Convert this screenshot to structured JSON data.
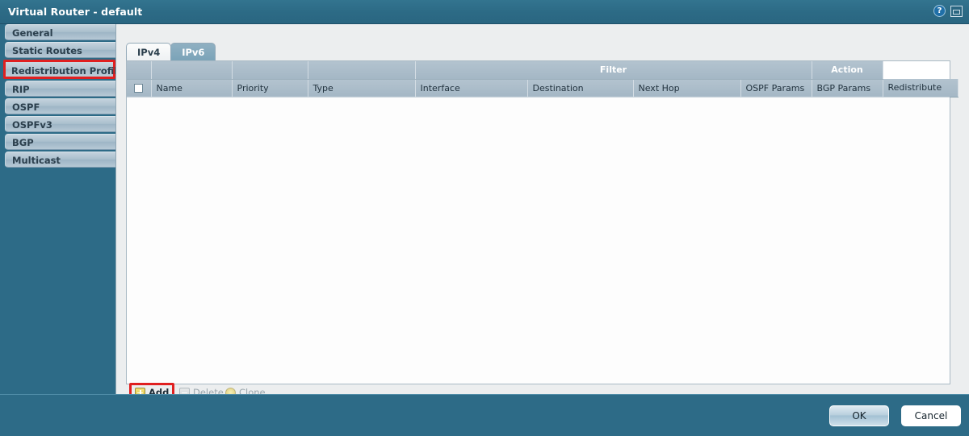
{
  "window": {
    "title": "Virtual Router - default",
    "help_icon": "help-icon",
    "help_glyph": "?",
    "window_icon": "window-icon"
  },
  "sidebar": {
    "items": [
      {
        "label": "General",
        "highlighted": false
      },
      {
        "label": "Static Routes",
        "highlighted": false
      },
      {
        "label": "Redistribution Profile",
        "highlighted": true
      },
      {
        "label": "RIP",
        "highlighted": false
      },
      {
        "label": "OSPF",
        "highlighted": false
      },
      {
        "label": "OSPFv3",
        "highlighted": false
      },
      {
        "label": "BGP",
        "highlighted": false
      },
      {
        "label": "Multicast",
        "highlighted": false
      }
    ]
  },
  "tabs": [
    {
      "label": "IPv4",
      "active": true
    },
    {
      "label": "IPv6",
      "active": false
    }
  ],
  "table": {
    "group_headers": [
      {
        "label": "",
        "span": 3
      },
      {
        "label": "Filter",
        "span": 4
      },
      {
        "label": "Action",
        "span": 1
      }
    ],
    "columns": [
      "Name",
      "Priority",
      "Type",
      "Interface",
      "Destination",
      "Next Hop",
      "OSPF Params",
      "BGP Params",
      "Redistribute"
    ],
    "select_all_checkbox": "unchecked",
    "rows": []
  },
  "grid_toolbar": {
    "buttons": [
      {
        "label": "Add",
        "icon": "plus-icon",
        "enabled": true,
        "highlighted": true
      },
      {
        "label": "Delete",
        "icon": "minus-icon",
        "enabled": false,
        "highlighted": false
      },
      {
        "label": "Clone",
        "icon": "clone-icon",
        "enabled": false,
        "highlighted": false
      }
    ]
  },
  "footer": {
    "ok_label": "OK",
    "cancel_label": "Cancel"
  },
  "colors": {
    "chrome_teal": "#2d6b87",
    "header_gray": "#a9bac7",
    "highlight_red": "#e02020",
    "accent_yellow": "#dcc44a"
  }
}
